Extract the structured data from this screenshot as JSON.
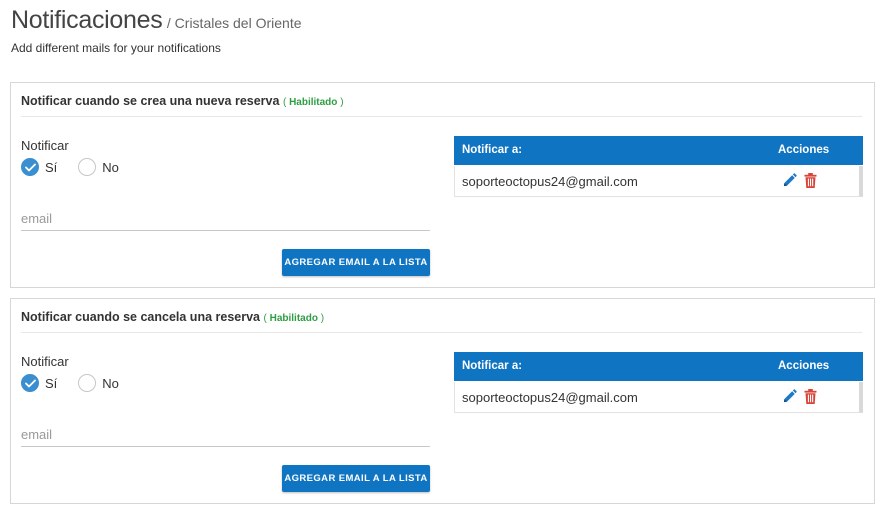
{
  "header": {
    "title": "Notificaciones",
    "subtitle": "/ Cristales del Oriente",
    "description": "Add different mails for your notifications"
  },
  "sections": [
    {
      "title": "Notificar cuando se crea una nueva reserva",
      "status_open": "(",
      "status": "Habilitado",
      "status_close": ")",
      "notify_label": "Notificar",
      "options": [
        {
          "label": "Sí",
          "checked": true
        },
        {
          "label": "No",
          "checked": false
        }
      ],
      "email_placeholder": "email",
      "email_value": "",
      "add_button_label": "AGREGAR EMAIL A LA LISTA",
      "table": {
        "headers": {
          "email": "Notificar a:",
          "actions": "Acciones"
        },
        "rows": [
          {
            "email": "soporteoctopus24@gmail.com"
          }
        ]
      }
    },
    {
      "title": "Notificar cuando se cancela una reserva",
      "status_open": "(",
      "status": "Habilitado",
      "status_close": ")",
      "notify_label": "Notificar",
      "options": [
        {
          "label": "Sí",
          "checked": true
        },
        {
          "label": "No",
          "checked": false
        }
      ],
      "email_placeholder": "email",
      "email_value": "",
      "add_button_label": "AGREGAR EMAIL A LA LISTA",
      "table": {
        "headers": {
          "email": "Notificar a:",
          "actions": "Acciones"
        },
        "rows": [
          {
            "email": "soporteoctopus24@gmail.com"
          }
        ]
      }
    }
  ],
  "icons": {
    "check": "check-icon",
    "edit": "pencil-icon",
    "delete": "trash-icon"
  },
  "colors": {
    "primary": "#0f74c2",
    "radio_checked": "#3a8fd0",
    "status_enabled": "#2e9e44",
    "edit_icon": "#1d78c7",
    "delete_icon": "#d9443a"
  }
}
